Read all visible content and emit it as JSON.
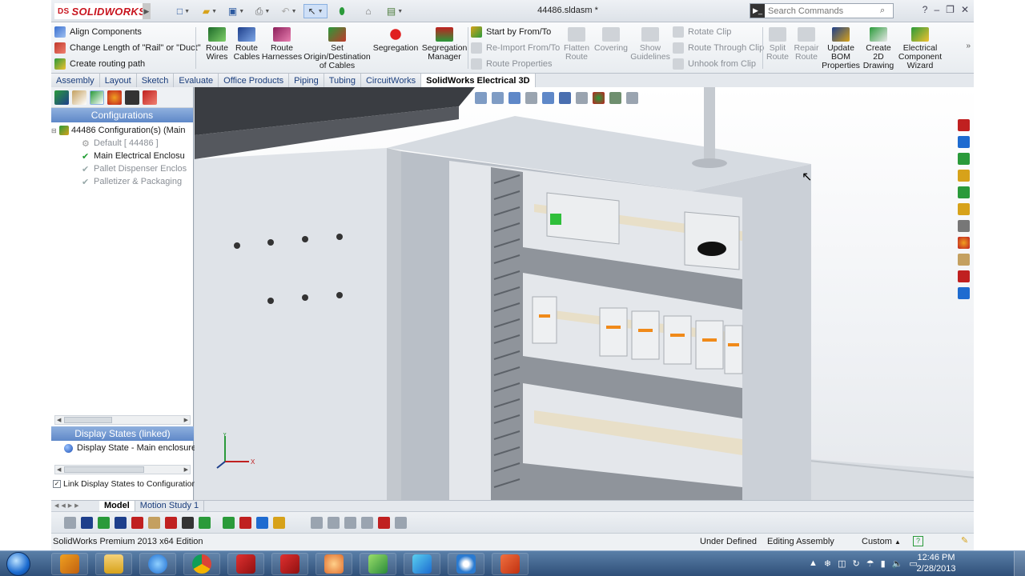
{
  "app": {
    "logo_text": "SOLIDWORKS",
    "logo_prefix": "DS",
    "document_title": "44486.sldasm *",
    "search_placeholder": "Search Commands"
  },
  "command_manager": {
    "left_items": [
      {
        "label": "Align Components"
      },
      {
        "label": "Change Length of \"Rail\" or \"Duct\""
      },
      {
        "label": "Create routing path"
      }
    ],
    "big_buttons": [
      {
        "label": "Route Wires"
      },
      {
        "label": "Route Cables"
      },
      {
        "label": "Route Harnesses"
      },
      {
        "label": "Set Origin/Destination of Cables"
      },
      {
        "label": "Segregation"
      },
      {
        "label": "Segregation Manager"
      }
    ],
    "mid_items": [
      {
        "label": "Start by From/To"
      },
      {
        "label": "Re-Import From/To"
      },
      {
        "label": "Route Properties"
      }
    ],
    "mid_buttons": [
      {
        "label": "Flatten Route"
      },
      {
        "label": "Covering"
      },
      {
        "label": "Show Guidelines"
      }
    ],
    "clip_items": [
      {
        "label": "Rotate Clip"
      },
      {
        "label": "Route Through Clip"
      },
      {
        "label": "Unhook from Clip"
      }
    ],
    "right_buttons": [
      {
        "label": "Split Route"
      },
      {
        "label": "Repair Route"
      },
      {
        "label": "Update BOM Properties"
      },
      {
        "label": "Create 2D Drawing"
      },
      {
        "label": "Electrical Component Wizard"
      }
    ]
  },
  "tabs": [
    {
      "label": "Assembly"
    },
    {
      "label": "Layout"
    },
    {
      "label": "Sketch"
    },
    {
      "label": "Evaluate"
    },
    {
      "label": "Office Products"
    },
    {
      "label": "Piping"
    },
    {
      "label": "Tubing"
    },
    {
      "label": "CircuitWorks"
    },
    {
      "label": "SolidWorks Electrical 3D"
    }
  ],
  "feature_manager": {
    "header": "Configurations",
    "root": "44486 Configuration(s)  (Main",
    "nodes": [
      {
        "label": "Default [ 44486 ]",
        "active": false
      },
      {
        "label": "Main Electrical Enclosu",
        "active": true
      },
      {
        "label": "Pallet Dispenser Enclos",
        "active": false
      },
      {
        "label": "Palletizer & Packaging",
        "active": false
      }
    ],
    "display_states_header": "Display States (linked)",
    "display_state": "Display State - Main enclosure",
    "link_label": "Link Display States to Configurations"
  },
  "triad": {
    "x_label": "X",
    "y_label": "Y"
  },
  "model_tabs": [
    {
      "label": "Model"
    },
    {
      "label": "Motion Study 1"
    }
  ],
  "status": {
    "edition": "SolidWorks Premium 2013 x64 Edition",
    "defined": "Under Defined",
    "mode": "Editing Assembly",
    "units": "Custom"
  },
  "clock": {
    "time": "12:46 PM",
    "date": "2/28/2013"
  },
  "colors": {
    "accent": "#5f88c8",
    "logo_red": "#c8141e",
    "enclosure": "#c9ced6",
    "taskbar": "#2f4f78"
  }
}
